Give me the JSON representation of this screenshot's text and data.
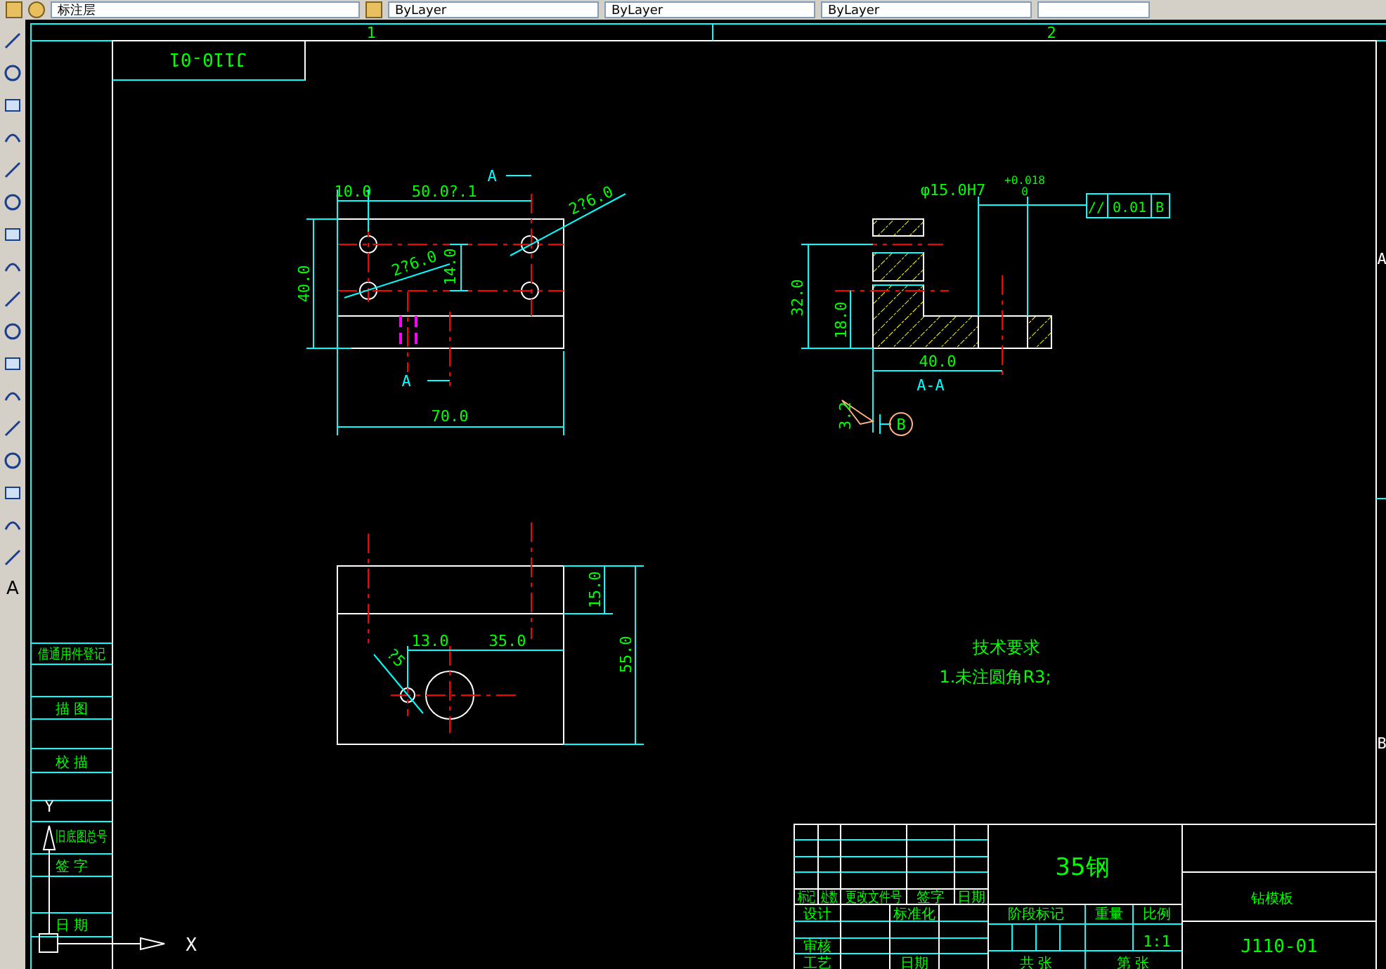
{
  "toolbar": {
    "layer": "标注层",
    "properties": [
      "ByLayer",
      "ByLayer",
      "ByLayer"
    ]
  },
  "tool_palette": {
    "text_tool": "A"
  },
  "ruler": {
    "zones": [
      "1",
      "2"
    ],
    "rows": [
      "A",
      "B"
    ]
  },
  "drawing_number_box": "J110-01",
  "left_strip": [
    "借通用件登记",
    "描 图",
    "校 描",
    "旧底图总号",
    "签 字",
    "日 期"
  ],
  "ucs": {
    "x": "X",
    "y": "Y"
  },
  "top_view": {
    "dims": [
      "10.0",
      "50.0?.1",
      "40.0",
      "14.0",
      "70.0",
      "2?6.0",
      "2?6.0"
    ],
    "section_marks": [
      "A",
      "A"
    ]
  },
  "section_view": {
    "dims": [
      "32.0",
      "18.0",
      "40.0"
    ],
    "title": "A-A",
    "hole": "φ15.0H7",
    "tol_upper": "+0.018",
    "tol_lower": "0",
    "tolerance_frame": [
      "//",
      "0.01",
      "B"
    ],
    "roughness": "3.2",
    "datum": "B"
  },
  "bottom_view": {
    "dims": [
      "15.0",
      "55.0",
      "13.0",
      "35.0",
      "?5"
    ]
  },
  "notes": {
    "title": "技术要求",
    "items": [
      "1.未注圆角R3;"
    ]
  },
  "title_block": {
    "headers": [
      "标记",
      "处数",
      "更改文件号",
      "签字",
      "日期"
    ],
    "signatures": [
      "设计",
      "标准化",
      "审核",
      "工艺",
      "日期"
    ],
    "material": "35钢",
    "stage_labels": [
      "阶段标记",
      "重量",
      "比例"
    ],
    "scale": "1:1",
    "sheets": [
      "共 张",
      "第 张"
    ],
    "part_name": "钻模板",
    "drawing_number": "J110-01"
  }
}
